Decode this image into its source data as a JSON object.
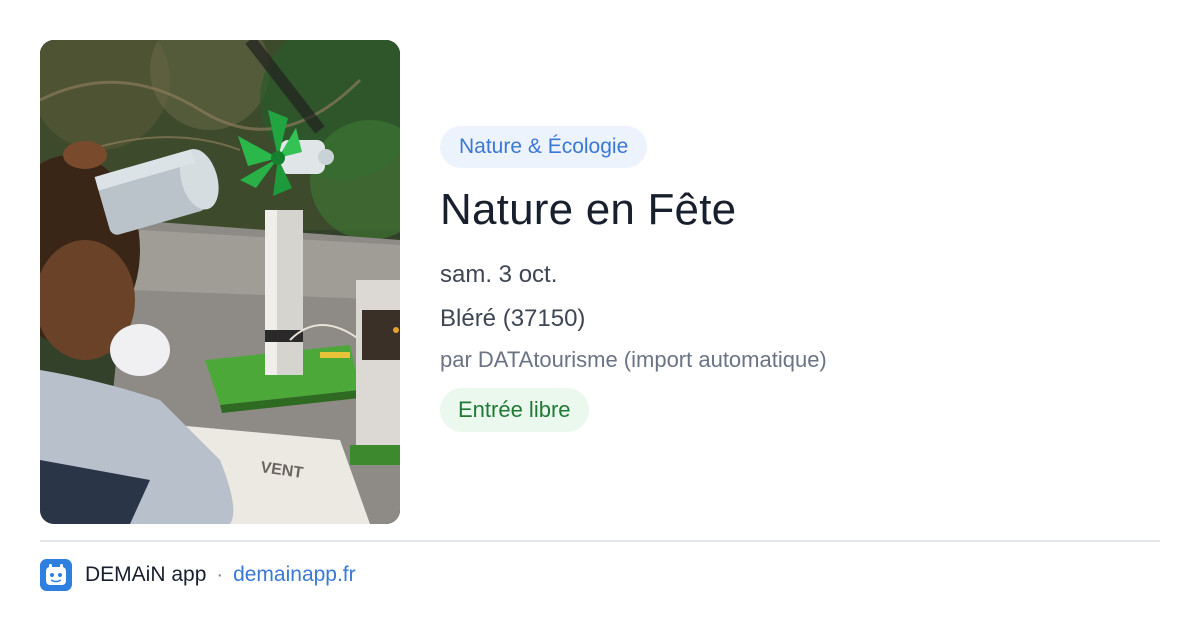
{
  "event": {
    "category": "Nature & Écologie",
    "title": "Nature en Fête",
    "date": "sam. 3 oct.",
    "location": "Bléré (37150)",
    "organizer": "par DATAtourisme (import automatique)",
    "price": "Entrée libre"
  },
  "footer": {
    "app_name": "DEMAiN app",
    "separator": "·",
    "url": "demainapp.fr"
  },
  "photo": {
    "sign_text": "VENT"
  },
  "icons": {
    "app": "demain-app-icon"
  },
  "colors": {
    "category_bg": "#edf3fd",
    "category_text": "#3a78d6",
    "price_bg": "#ebf8ee",
    "price_text": "#1f7a35",
    "title": "#18202e",
    "link": "#3a78d6"
  }
}
